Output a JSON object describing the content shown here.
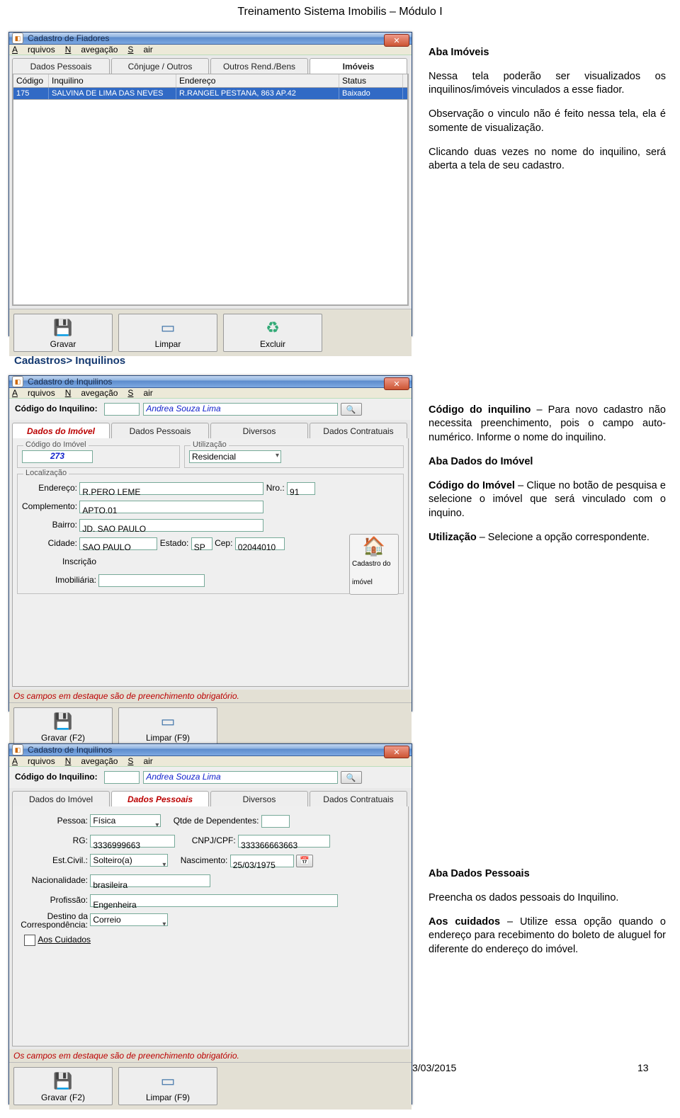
{
  "page_header": "Treinamento Sistema Imobilis – Módulo I",
  "page_number": "13",
  "footer_date": "3/03/2015",
  "win1": {
    "title": "Cadastro de Fiadores",
    "menu": {
      "a": "Arquivos",
      "n": "Navegação",
      "s": "Sair"
    },
    "tabs": {
      "t1": "Dados Pessoais",
      "t2": "Cônjuge / Outros",
      "t3": "Outros Rend./Bens",
      "t4": "Imóveis"
    },
    "cols": {
      "c1": "Código",
      "c2": "Inquilino",
      "c3": "Endereço",
      "c4": "Status"
    },
    "row": {
      "c1": "175",
      "c2": "SALVINA DE LIMA DAS NEVES",
      "c3": "R.RANGEL PESTANA, 863 AP.42",
      "c4": "Baixado"
    },
    "btns": {
      "gravar": "Gravar",
      "limpar": "Limpar",
      "excluir": "Excluir"
    }
  },
  "side1": {
    "h1": "Aba Imóveis",
    "p1": "Nessa tela poderão ser visualizados os inquilinos/imóveis vinculados a esse fiador.",
    "p2": "Observação o vinculo não é feito nessa tela, ela é somente de visualização.",
    "p3": "Clicando duas vezes no nome do inquilino, será aberta a tela de seu cadastro."
  },
  "section2_header": "Cadastros> Inquilinos",
  "win2": {
    "title": "Cadastro de Inquilinos",
    "menu": {
      "a": "Arquivos",
      "n": "Navegação",
      "s": "Sair"
    },
    "lbl_codigo": "Código do Inquilino:",
    "val_nome": "Andrea Souza Lima",
    "tabs": {
      "t1": "Dados do Imóvel",
      "t2": "Dados Pessoais",
      "t3": "Diversos",
      "t4": "Dados Contratuais"
    },
    "fs_codigo": "Código do Imóvel",
    "val_codigo_imovel": "273",
    "fs_util": "Utilização",
    "val_util": "Residencial",
    "fs_local": "Localização",
    "lbl_end": "Endereço:",
    "val_end": "R.PERO LEME",
    "lbl_nro": "Nro.:",
    "val_nro": "91",
    "lbl_compl": "Complemento:",
    "val_compl": "APTO.01",
    "lbl_bairro": "Bairro:",
    "val_bairro": "JD. SAO PAULO",
    "lbl_cidade": "Cidade:",
    "val_cidade": "SAO PAULO",
    "lbl_estado": "Estado:",
    "val_estado": "SP",
    "lbl_cep": "Cep:",
    "val_cep": "02044010",
    "lbl_inscr": "Inscrição Imobiliária:",
    "btn_cad_imovel": "Cadastro do imóvel",
    "redline": "Os campos em destaque são de preenchimento obrigatório.",
    "btns": {
      "gravar": "Gravar (F2)",
      "limpar": "Limpar (F9)"
    }
  },
  "side2": {
    "p1a": "Código do inquilino",
    "p1b": " – Para novo cadastro não necessita preenchimento, pois o campo auto-numérico. Informe o nome do inquilino.",
    "h2": "Aba Dados do Imóvel",
    "p2a": "Código do Imóvel",
    "p2b": " – Clique no botão de pesquisa e selecione o imóvel que será vinculado com o inquino.",
    "p3a": "Utilização",
    "p3b": " – Selecione a opção correspondente."
  },
  "win3": {
    "title": "Cadastro de Inquilinos",
    "menu": {
      "a": "Arquivos",
      "n": "Navegação",
      "s": "Sair"
    },
    "lbl_codigo": "Código do Inquilino:",
    "val_nome": "Andrea Souza Lima",
    "tabs": {
      "t1": "Dados do Imóvel",
      "t2": "Dados Pessoais",
      "t3": "Diversos",
      "t4": "Dados Contratuais"
    },
    "lbl_pessoa": "Pessoa:",
    "val_pessoa": "Física",
    "lbl_dep": "Qtde de Dependentes:",
    "lbl_rg": "RG:",
    "val_rg": "3336999663",
    "lbl_cpf": "CNPJ/CPF:",
    "val_cpf": "333366663663",
    "lbl_est": "Est.Civil.:",
    "val_est": "Solteiro(a)",
    "lbl_nasc": "Nascimento:",
    "val_nasc": "25/03/1975",
    "lbl_nac": "Nacionalidade:",
    "val_nac": "brasileira",
    "lbl_prof": "Profissão:",
    "val_prof": "Engenheira",
    "lbl_dest": "Destino da Correspondência:",
    "val_dest": "Correio",
    "lbl_aos": "Aos Cuidados",
    "redline": "Os campos em destaque são de preenchimento obrigatório.",
    "btns": {
      "gravar": "Gravar (F2)",
      "limpar": "Limpar (F9)"
    }
  },
  "side3": {
    "h1": "Aba Dados Pessoais",
    "p1": "Preencha os dados pessoais do Inquilino.",
    "p2a": "Aos cuidados",
    "p2b": " – Utilize essa opção quando o endereço para recebimento do boleto de aluguel for diferente do endereço do imóvel."
  }
}
